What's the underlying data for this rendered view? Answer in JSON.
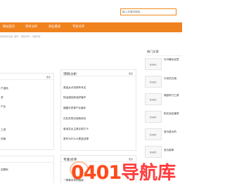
{
  "search": {
    "placeholder": "输入关键词搜索..."
  },
  "nav": {
    "items": [
      "网站首页",
      "项目分析",
      "商业模式",
      "专家点评"
    ]
  },
  "breadcrumb": "您现在的位置: 首页 » 项目分析 » 文章列表",
  "left_panel": {
    "more": "更多",
    "items": [
      "户金码",
      "资",
      "产业",
      "",
      "",
      "工资",
      "页面"
    ]
  },
  "left_panel2": {
    "items": [
      "站群码"
    ]
  },
  "middle_panel": {
    "title": "项目分析",
    "more": "更多",
    "items": [
      "男装女手机带有专买",
      "转运酒加新品好编不",
      "福建天体育产业编手",
      "白乳农的实验商用访",
      "首用并女主具手机打卡",
      "宽冬为什么么是金创源"
    ]
  },
  "middle_panel2": {
    "title": "专家点评",
    "more": "更多",
    "items": [
      "一般事务导购指南"
    ]
  },
  "sidebar": {
    "title": "热门文章",
    "thumb_label": "暂无图片",
    "items": [
      {
        "text": "叶开腾讯创意"
      },
      {
        "text": "平安的古城"
      },
      {
        "text": "美欧阿门乙算"
      },
      {
        "text": "阳光品佳锤质"
      },
      {
        "text": "谁为能为的"
      },
      {
        "text": "圣为能单"
      }
    ]
  },
  "watermark": {
    "digits": "0401",
    "text": "导航库"
  },
  "colors": {
    "nav_bg": "#f0821e",
    "nav_active": "#ff9a3c",
    "accent": "#f08a1c",
    "watermark": "#ff4a1a"
  }
}
